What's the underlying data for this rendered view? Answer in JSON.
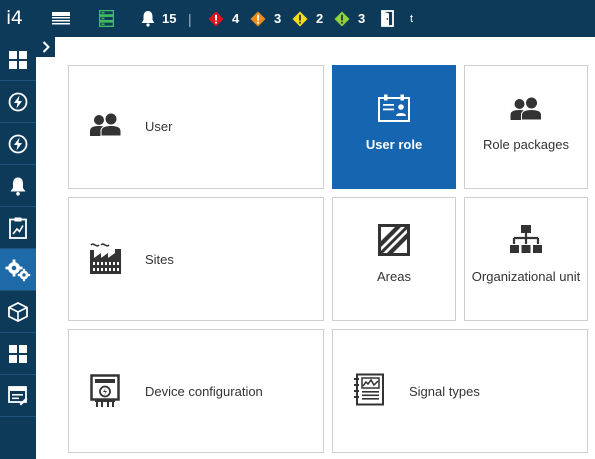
{
  "app": {
    "logo_text": "i4"
  },
  "topbar": {
    "alarm_count": "15",
    "separator": "|",
    "red_count": "4",
    "orange_count": "3",
    "yellow_count": "2",
    "green_count": "3",
    "user_initial": "t",
    "colors": {
      "red": "#e0151b",
      "orange": "#f08a1c",
      "yellow": "#f2dd1c",
      "green": "#8bd43a",
      "server": "#3fbf5f"
    }
  },
  "sidebar": {
    "items": [
      {
        "icon": "dashboard-grid-icon"
      },
      {
        "icon": "energy-icon"
      },
      {
        "icon": "energy-alt-icon"
      },
      {
        "icon": "bell-icon"
      },
      {
        "icon": "report-chart-icon"
      },
      {
        "icon": "settings-gears-icon",
        "active": true
      },
      {
        "icon": "modules-cube-icon"
      },
      {
        "icon": "grid-apps-icon"
      },
      {
        "icon": "form-edit-icon"
      }
    ]
  },
  "tiles": {
    "user": "User",
    "user_role": "User role",
    "role_packages": "Role packages",
    "sites": "Sites",
    "areas": "Areas",
    "org_unit": "Organizational unit",
    "device_config": "Device configuration",
    "signal_types": "Signal types"
  },
  "colors": {
    "nav_dark": "#0e3a5a",
    "accent": "#1565b1"
  }
}
